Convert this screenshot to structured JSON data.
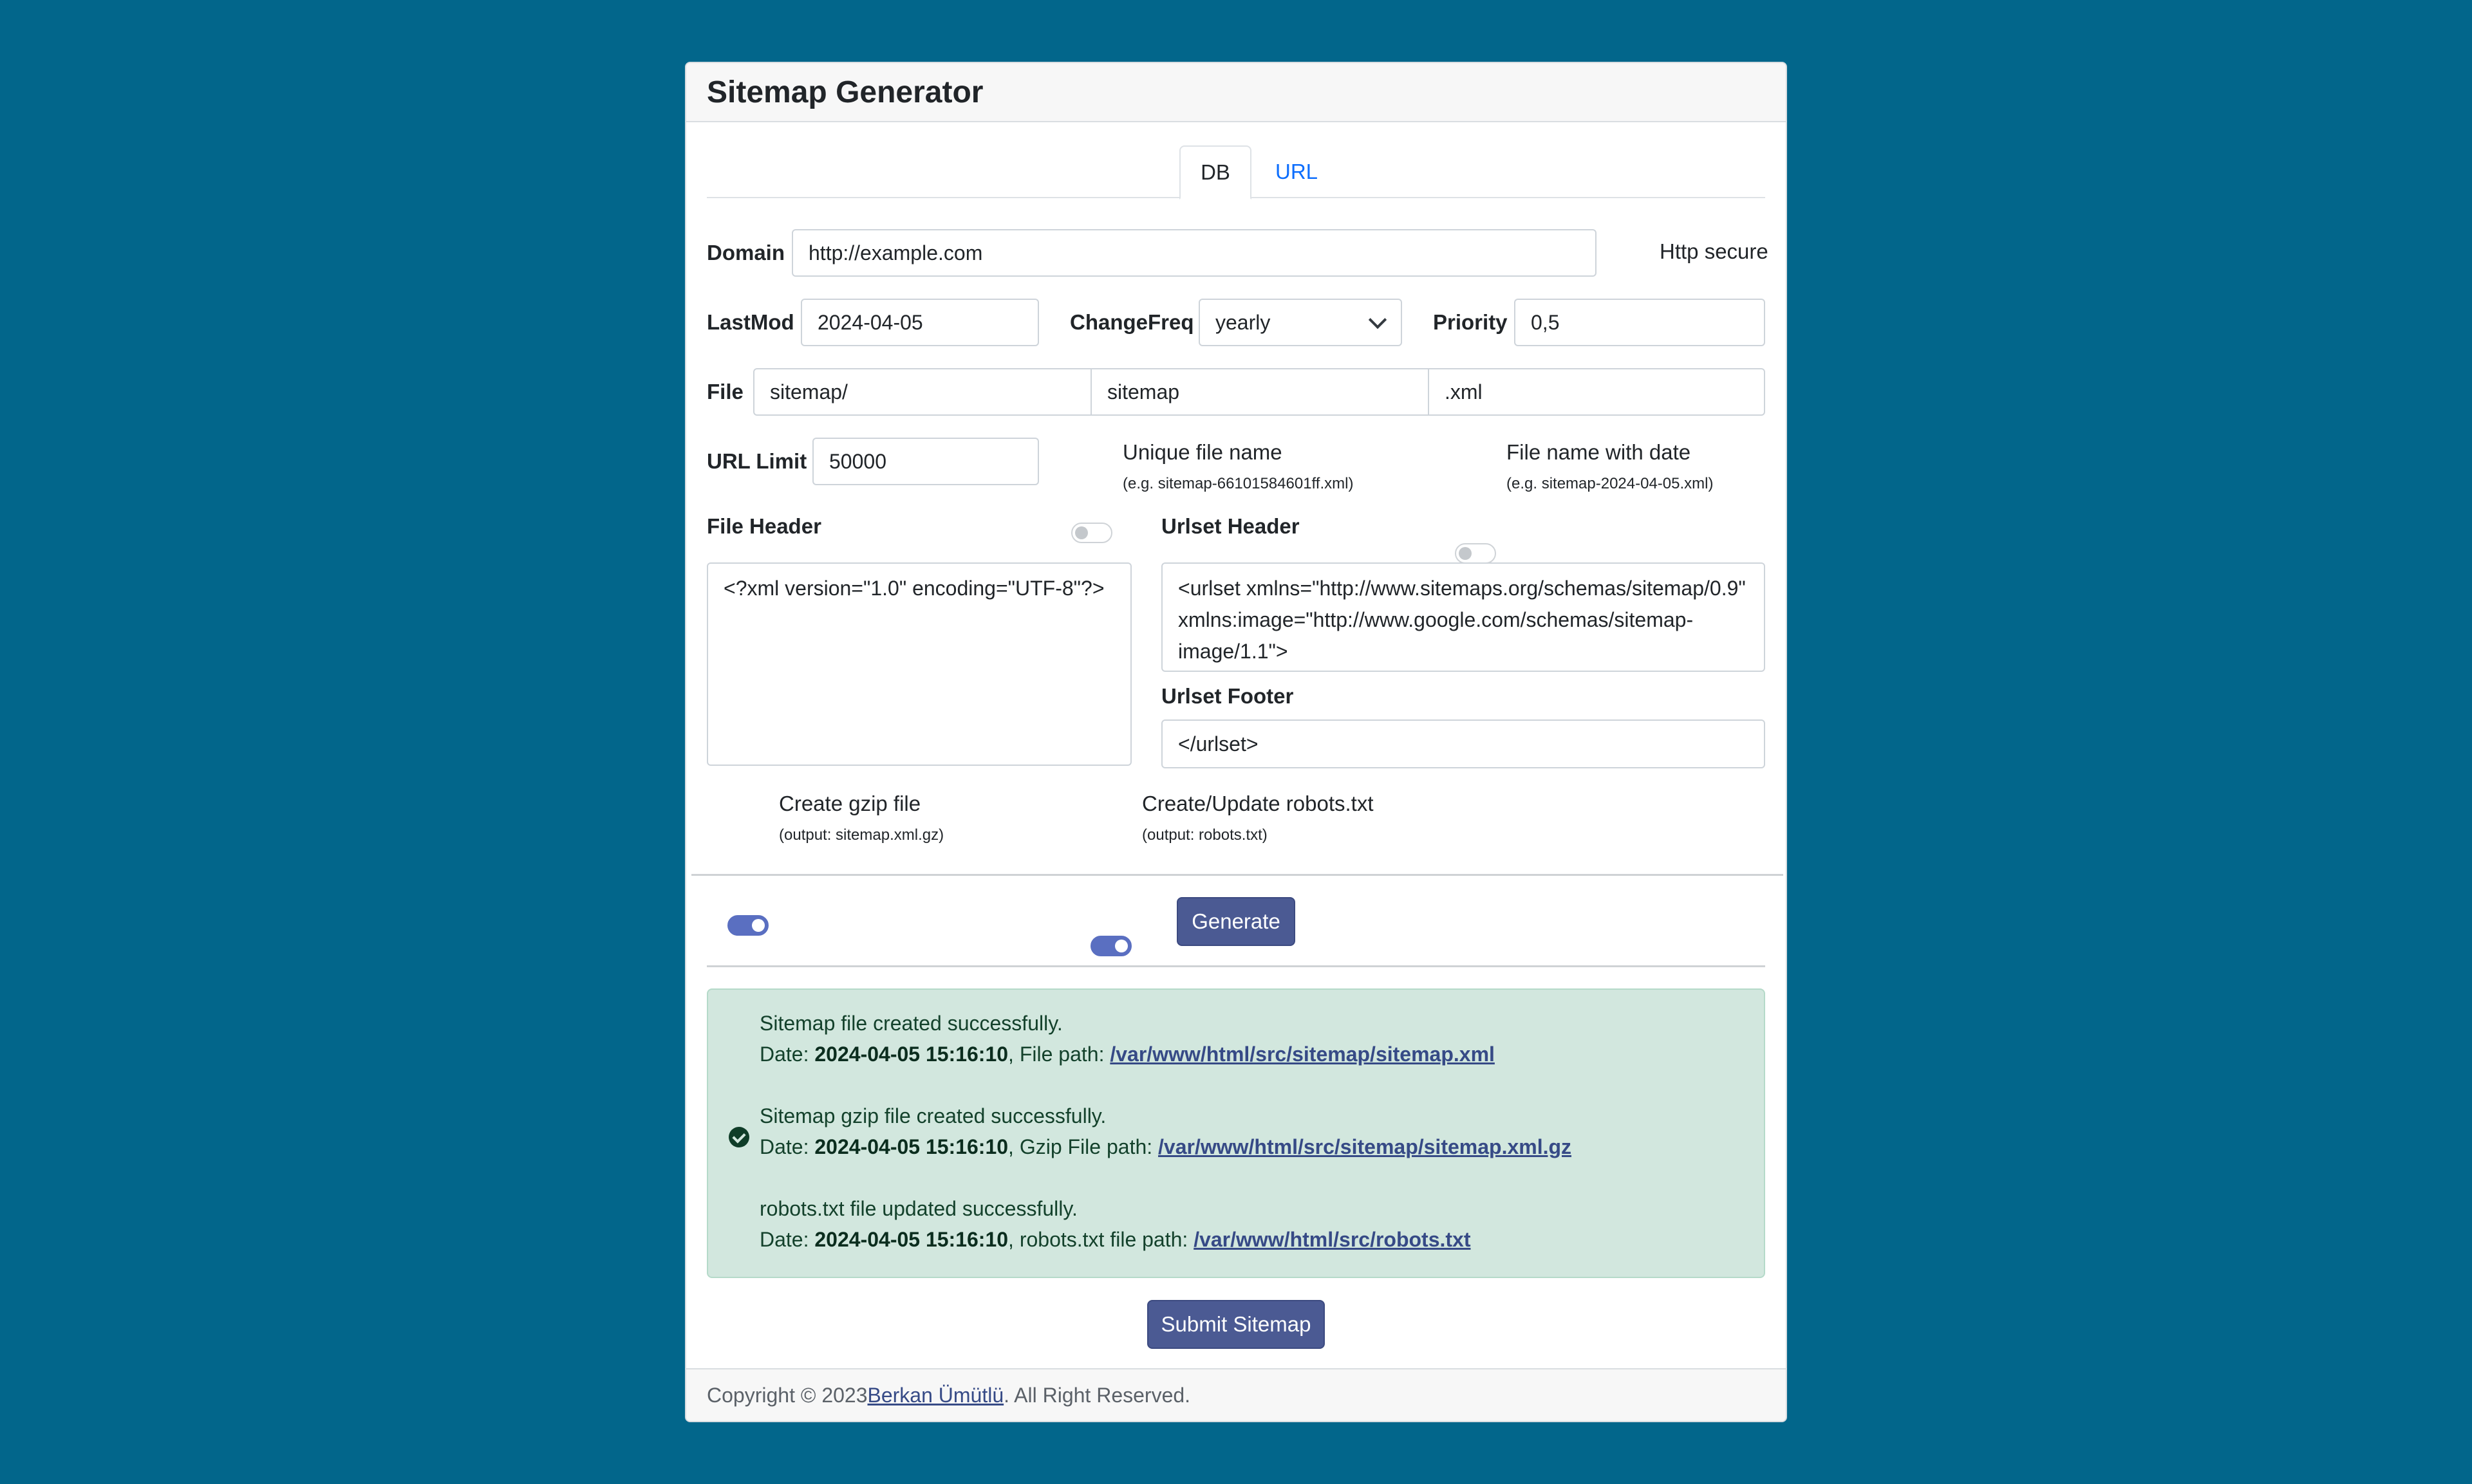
{
  "header": {
    "title": "Sitemap Generator"
  },
  "tabs": [
    {
      "label": "DB",
      "active": true
    },
    {
      "label": "URL",
      "active": false
    }
  ],
  "domain": {
    "label": "Domain",
    "value": "http://example.com"
  },
  "http_secure": {
    "label": "Http secure",
    "checked": false
  },
  "lastmod": {
    "label": "LastMod",
    "value": "2024-04-05"
  },
  "changefreq": {
    "label": "ChangeFreq",
    "value": "yearly"
  },
  "priority": {
    "label": "Priority",
    "value": "0,5"
  },
  "file": {
    "label": "File",
    "dir": "sitemap/",
    "name": "sitemap",
    "ext": ".xml"
  },
  "url_limit": {
    "label": "URL Limit",
    "value": "50000"
  },
  "unique_file_name": {
    "label": "Unique file name",
    "note": "(e.g. sitemap-66101584601ff.xml)",
    "checked": false
  },
  "file_name_with_date": {
    "label": "File name with date",
    "note": "(e.g. sitemap-2024-04-05.xml)",
    "checked": false
  },
  "file_header": {
    "label": "File Header",
    "value": "<?xml version=\"1.0\" encoding=\"UTF-8\"?>"
  },
  "urlset_header": {
    "label": "Urlset Header",
    "value": "<urlset xmlns=\"http://www.sitemaps.org/schemas/sitemap/0.9\" xmlns:image=\"http://www.google.com/schemas/sitemap-image/1.1\">"
  },
  "urlset_footer": {
    "label": "Urlset Footer",
    "value": "</urlset>"
  },
  "gzip": {
    "label": "Create gzip file",
    "note": "(output: sitemap.xml.gz)",
    "checked": true
  },
  "robots": {
    "label": "Create/Update robots.txt",
    "note": "(output: robots.txt)",
    "checked": true
  },
  "generate_button": "Generate",
  "result": {
    "sitemap": {
      "message": "Sitemap file created successfully.",
      "date_prefix": "Date: ",
      "date": "2024-04-05 15:16:10",
      "path_prefix": ", File path: ",
      "path": "/var/www/html/src/sitemap/sitemap.xml"
    },
    "gzip": {
      "message": "Sitemap gzip file created successfully.",
      "date_prefix": "Date: ",
      "date": "2024-04-05 15:16:10",
      "path_prefix": ", Gzip File path: ",
      "path": "/var/www/html/src/sitemap/sitemap.xml.gz"
    },
    "robots": {
      "message": "robots.txt file updated successfully.",
      "date_prefix": "Date: ",
      "date": "2024-04-05 15:16:10",
      "path_prefix": ", robots.txt file path: ",
      "path": "/var/www/html/src/robots.txt"
    }
  },
  "submit_button": "Submit Sitemap",
  "footer": {
    "prefix": "Copyright © 2023 ",
    "author": "Berkan Ümütlü",
    "suffix": ". All Right Reserved."
  },
  "colors": {
    "page_background": "#02668b",
    "primary_button": "#4b5a93",
    "switch_on": "#5a6fc1",
    "success_alert": "#d2e7de",
    "tab_link": "#0d6efd"
  },
  "icons": [
    "check-circle-icon",
    "chevron-down-icon"
  ]
}
